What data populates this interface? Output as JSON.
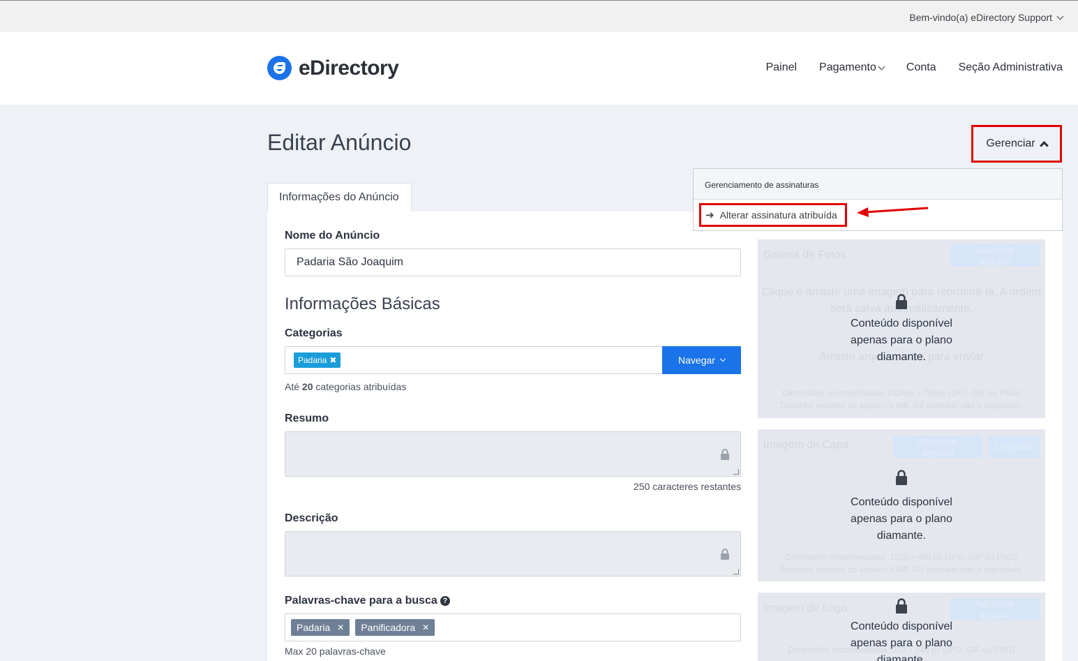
{
  "topbar": {
    "welcome": "Bem-vindo(a) eDirectory Support"
  },
  "header": {
    "logo_text": "eDirectory",
    "nav": [
      "Painel",
      "Pagamento",
      "Conta",
      "Seção Administrativa"
    ]
  },
  "page": {
    "title": "Editar Anúncio",
    "manage_button": "Gerenciar",
    "tab": "Informações do Anúncio"
  },
  "dropdown": {
    "header": "Gerenciamento de assinaturas",
    "item": "Alterar assinatura atribuída"
  },
  "form": {
    "name_label": "Nome do Anúncio",
    "name_value": "Padaria São Joaquim",
    "basic_title": "Informações Básicas",
    "categories_label": "Categorias",
    "category_tag": "Padaria",
    "browse_button": "Navegar",
    "categories_hint_prefix": "Até",
    "categories_hint_count": "20",
    "categories_hint_suffix": "categorias atribuídas",
    "summary_label": "Resumo",
    "summary_remaining": "250 caracteres restantes",
    "description_label": "Descrição",
    "keywords_label": "Palavras-chave para a busca",
    "keywords": [
      "Padaria",
      "Panificadora"
    ],
    "keywords_hint": "Max 20 palavras-chave"
  },
  "panels": {
    "locked_text_1": "Conteúdo disponível",
    "locked_text_2": "apenas para o plano",
    "locked_text_3": "diamante.",
    "gallery": {
      "title": "Galeria de Fotos",
      "add_button": "Adicionar arquivo",
      "line1": "Clique e arraste uma imagem para reordená-la. A ordem",
      "line2": "será salva automaticamente.",
      "line3": "Arraste arquivos aqui para enviar",
      "dims": "Dimensões recomendadas: 1024px x 768px (JPG, GIF ou PNG)",
      "size": "Tamanho máximo do arquivo 5 MB. Gif animado não é suportado."
    },
    "cover": {
      "title": "Imagem de Capa",
      "add_button": "Adicionar arquivo",
      "unsplash_button": "Unsplash",
      "dims": "Dimensões recomendadas: 1920 x 480 px (JPG, GIF ou PNG)",
      "size": "Tamanho máximo do arquivo 5 MB. Gif animado não é suportado."
    },
    "logo": {
      "title": "Imagem de Logo",
      "add_button": "Adicionar arquivo",
      "dims": "Dimensões recomendadas: 320 x 240 px (JPG, GIF ou PNG)"
    }
  },
  "colors": {
    "brand": "#1a73e8",
    "highlight": "#e00000",
    "tag": "#1a9dd9"
  }
}
